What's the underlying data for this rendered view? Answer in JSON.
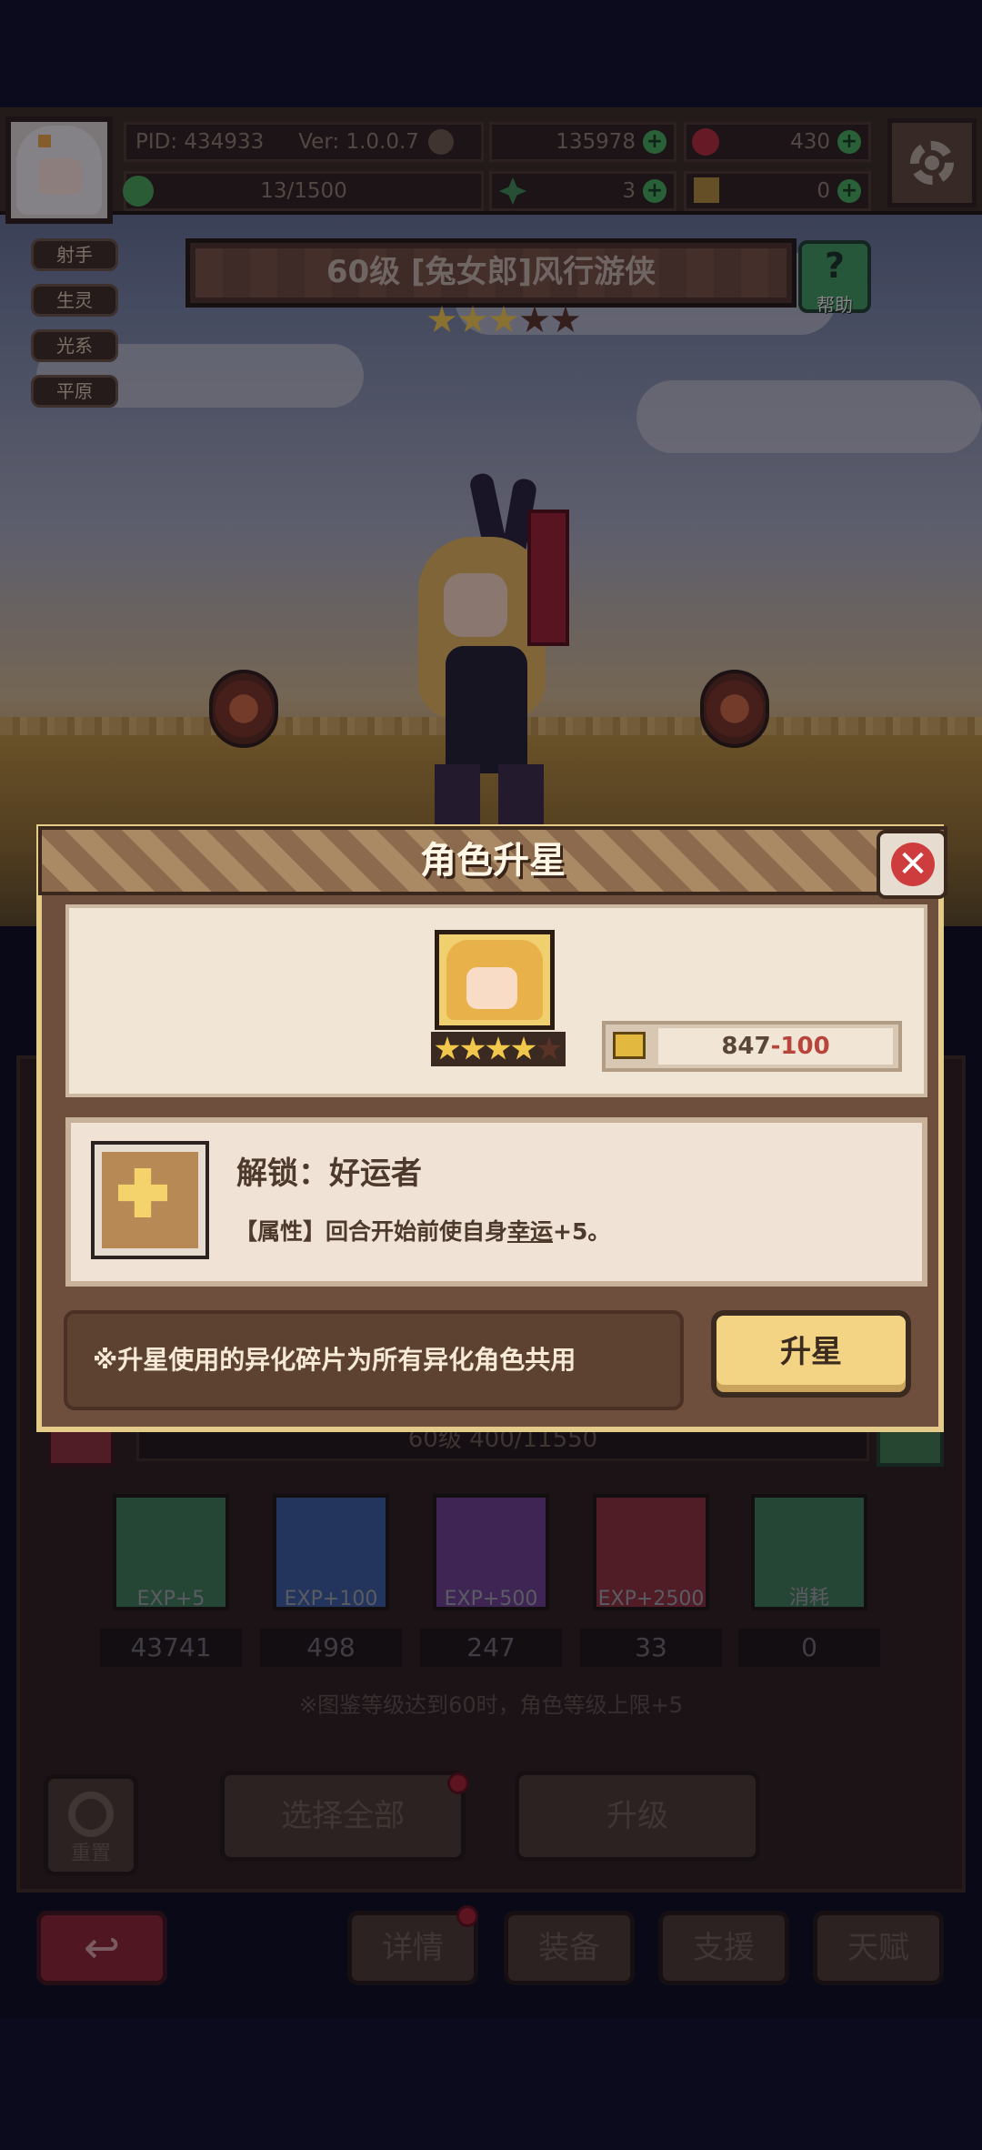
{
  "hud": {
    "pid": "PID: 434933",
    "version": "Ver: 1.0.0.7",
    "currency1": "135978",
    "currency2": "430",
    "stamina": "13/1500",
    "clover": "3",
    "keys": "0"
  },
  "tags": [
    "射手",
    "生灵",
    "光系",
    "平原"
  ],
  "character": {
    "title": "60级  [兔女郎]风行游侠",
    "stars_filled": 3,
    "stars_total": 5
  },
  "help": {
    "label": "帮助",
    "symbol": "?"
  },
  "background_panel": {
    "level_text": "60级 400/11550",
    "exp_items": [
      {
        "label": "EXP+5",
        "count": "43741",
        "color": "#3f7a52"
      },
      {
        "label": "EXP+100",
        "count": "498",
        "color": "#3a5c9a"
      },
      {
        "label": "EXP+500",
        "count": "247",
        "color": "#6a3f8a"
      },
      {
        "label": "EXP+2500",
        "count": "33",
        "color": "#8a2f35"
      },
      {
        "label": "消耗",
        "count": "0",
        "color": "#3f7a52"
      }
    ],
    "note": "※图鉴等级达到60时，角色等级上限+5",
    "reset_label": "重置",
    "select_all": "选择全部",
    "upgrade": "升级",
    "tabs": [
      "详情",
      "装备",
      "支援",
      "天赋"
    ]
  },
  "modal": {
    "title": "角色升星",
    "close_symbol": "✕",
    "portrait_stars_filled": 4,
    "portrait_stars_total": 5,
    "shards_owned": "847",
    "shards_cost": "-100",
    "unlock_title": "解锁：好运者",
    "unlock_desc_prefix": "【属性】回合开始前使自身",
    "unlock_desc_keyword": "幸运",
    "unlock_desc_suffix": "+5。",
    "note": "※升星使用的异化碎片为所有异化角色共用",
    "star_button": "升星"
  },
  "colors": {
    "star_gold": "#f1c84b",
    "star_empty": "#5a3326",
    "accent_green": "#44a957",
    "cost_red": "#b8453b"
  }
}
